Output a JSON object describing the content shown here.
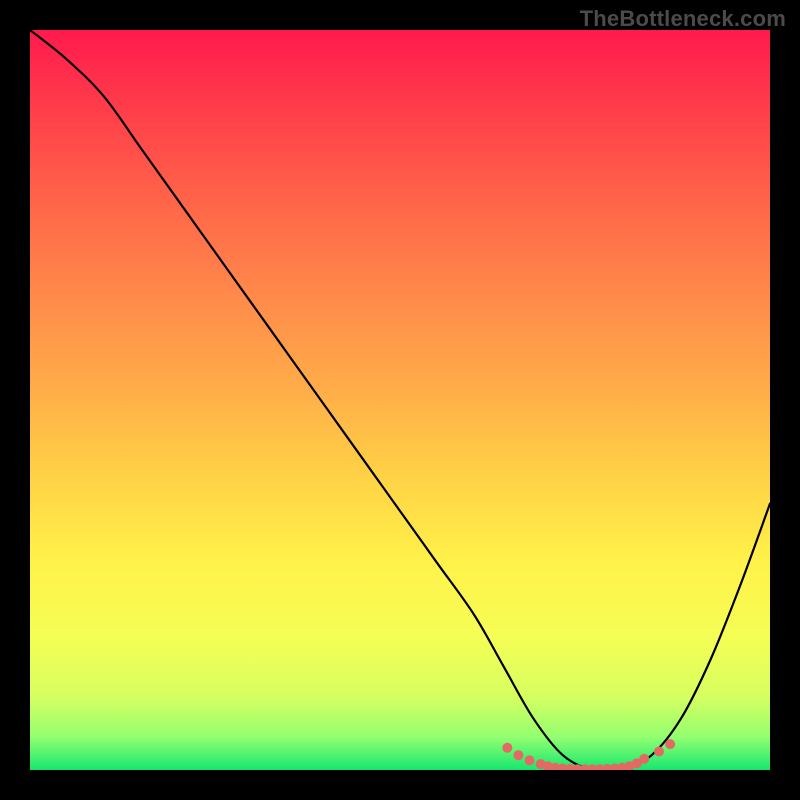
{
  "watermark": "TheBottleneck.com",
  "chart_data": {
    "type": "line",
    "title": "",
    "xlabel": "",
    "ylabel": "",
    "xlim": [
      0,
      100
    ],
    "ylim": [
      0,
      100
    ],
    "grid": false,
    "legend": false,
    "series": [
      {
        "name": "curve",
        "x": [
          0,
          5,
          10,
          15,
          20,
          25,
          30,
          35,
          40,
          45,
          50,
          55,
          60,
          64,
          68,
          72,
          76,
          80,
          84,
          88,
          92,
          96,
          100
        ],
        "y": [
          100,
          96,
          91,
          84,
          77,
          70,
          63,
          56,
          49,
          42,
          35,
          28,
          21,
          14,
          7,
          2,
          0,
          0,
          2,
          7,
          15,
          25,
          36
        ]
      }
    ],
    "markers": {
      "name": "dotted-valley",
      "x": [
        64.5,
        66,
        67.5,
        69,
        70,
        71,
        72,
        73,
        74,
        75,
        76,
        77,
        78,
        79,
        80,
        81,
        82,
        83,
        85,
        86.5
      ],
      "y": [
        3.0,
        2.0,
        1.3,
        0.8,
        0.5,
        0.3,
        0.2,
        0.15,
        0.1,
        0.1,
        0.1,
        0.1,
        0.15,
        0.2,
        0.3,
        0.5,
        0.9,
        1.5,
        2.5,
        3.5
      ],
      "color": "#e36a63",
      "radius": 5
    },
    "gradient_stops": [
      {
        "offset": 0.0,
        "color": "#ff1a4d"
      },
      {
        "offset": 0.1,
        "color": "#ff3b4a"
      },
      {
        "offset": 0.22,
        "color": "#ff6149"
      },
      {
        "offset": 0.35,
        "color": "#ff874a"
      },
      {
        "offset": 0.48,
        "color": "#ffab49"
      },
      {
        "offset": 0.6,
        "color": "#ffd145"
      },
      {
        "offset": 0.72,
        "color": "#fff24a"
      },
      {
        "offset": 0.82,
        "color": "#f5fe55"
      },
      {
        "offset": 0.9,
        "color": "#d7ff60"
      },
      {
        "offset": 0.955,
        "color": "#94ff70"
      },
      {
        "offset": 1.0,
        "color": "#16e76f"
      }
    ]
  }
}
